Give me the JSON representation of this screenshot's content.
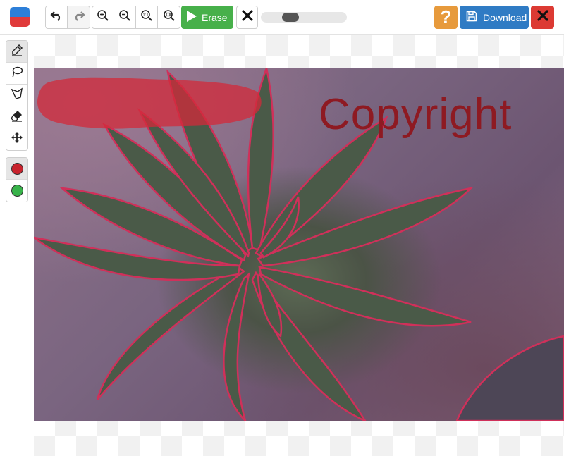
{
  "app": {
    "logo_icon": "app-logo-icon",
    "colors": {
      "erase_green": "#47b04a",
      "download_blue": "#2f7bc4",
      "help_orange": "#e79a3c",
      "close_red": "#dc3a33",
      "marker_red": "#c8232d",
      "marker_green": "#38b34a"
    }
  },
  "toolbar": {
    "history": [
      {
        "name": "undo-icon",
        "enabled": true
      },
      {
        "name": "redo-icon",
        "enabled": false
      }
    ],
    "zoom": [
      {
        "name": "zoom-in-icon"
      },
      {
        "name": "zoom-out-icon"
      },
      {
        "name": "zoom-actual-size-icon"
      },
      {
        "name": "zoom-fit-icon"
      }
    ],
    "erase_label": "Erase",
    "cancel_icon": "close-icon",
    "brush_size": 0.31,
    "help_label": "?",
    "download_label": "Download",
    "close_icon": "close-icon"
  },
  "sidebar": {
    "tools": [
      {
        "name": "brush-tool",
        "icon": "pencil-icon",
        "active": true
      },
      {
        "name": "lasso-tool",
        "icon": "lasso-icon",
        "active": false
      },
      {
        "name": "polygon-lasso-tool",
        "icon": "polygon-lasso-icon",
        "active": false
      },
      {
        "name": "eraser-tool",
        "icon": "eraser-icon",
        "active": false
      },
      {
        "name": "move-tool",
        "icon": "move-icon",
        "active": false
      }
    ],
    "colors": [
      {
        "name": "red-marker",
        "selected": true
      },
      {
        "name": "green-marker",
        "selected": false
      }
    ]
  },
  "canvas": {
    "watermark_text": "Copyright"
  }
}
